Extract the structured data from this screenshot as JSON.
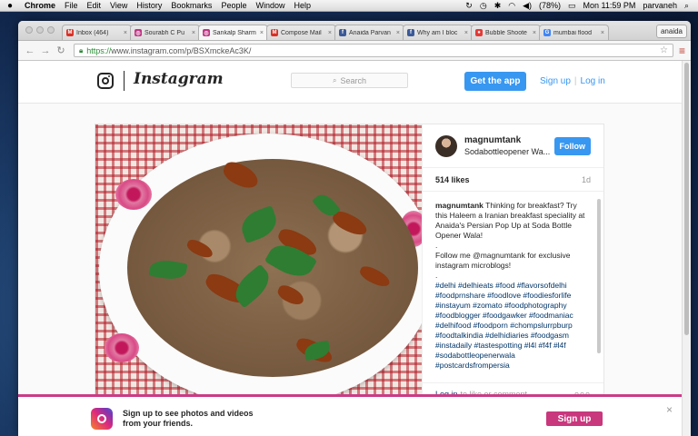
{
  "menubar": {
    "apple": "",
    "items": [
      "Chrome",
      "File",
      "Edit",
      "View",
      "History",
      "Bookmarks",
      "People",
      "Window",
      "Help"
    ],
    "battery": "(78%)",
    "clock": "Mon 11:59 PM",
    "user": "parvaneh"
  },
  "browser": {
    "tabs": [
      {
        "title": "Inbox (464)",
        "icon": "gmail-icon",
        "color": "#d93025",
        "glyph": "M"
      },
      {
        "title": "Sourabh C Pu",
        "icon": "instagram-icon",
        "color": "#c13584",
        "glyph": "◎"
      },
      {
        "title": "Sankalp Sharm",
        "icon": "instagram-icon",
        "color": "#c13584",
        "glyph": "◎"
      },
      {
        "title": "Compose Mail",
        "icon": "gmail-icon",
        "color": "#d93025",
        "glyph": "M"
      },
      {
        "title": "Anaida Parvan",
        "icon": "facebook-icon",
        "color": "#3b5998",
        "glyph": "f"
      },
      {
        "title": "Why am I bloc",
        "icon": "facebook-icon",
        "color": "#3b5998",
        "glyph": "f"
      },
      {
        "title": "Bubble Shoote",
        "icon": "game-icon",
        "color": "#e53935",
        "glyph": "●"
      },
      {
        "title": "mumbai flood",
        "icon": "google-icon",
        "color": "#4285f4",
        "glyph": "G"
      }
    ],
    "profile": "anaida",
    "url_https": "https://",
    "url_rest": "www.instagram.com/p/BSXmckeAc3K/"
  },
  "instagram": {
    "wordmark": "Instagram",
    "search_placeholder": "Search",
    "get_app": "Get the app",
    "sign_up": "Sign up",
    "log_in": "Log in",
    "post": {
      "username": "magnumtank",
      "location": "Sodabottleopener Wa...",
      "follow": "Follow",
      "likes": "514 likes",
      "age": "1d",
      "caption_user": "magnumtank",
      "caption_lines": [
        "Thinking for breakfast? Try this Haleem a Iranian breakfast speciality at Anaida's Persian Pop Up at Soda Bottle Opener Wala!",
        ".",
        "Follow me @magnumtank for exclusive instagram microblogs!",
        "."
      ],
      "hashtags": "#delhi #delhieats #food #flavorsofdelhi #foodprnshare #foodlove #foodiesforlife #instayum #zomato #foodphotography #foodblogger #foodgawker #foodmaniac #delhifood #foodporn #chompslurrpburp #foodtalkindia #delhidiaries #foodgasm #instadaily #tastespotting #l4l #f4f #l4f #sodabottleopenerwala #postcardsfrompersia",
      "login_link": "Log in",
      "login_rest": "to like or comment.",
      "more": "ooo"
    },
    "banner": {
      "line1": "Sign up to see photos and videos",
      "line2": "from your friends.",
      "button": "Sign up",
      "close": "×"
    }
  }
}
